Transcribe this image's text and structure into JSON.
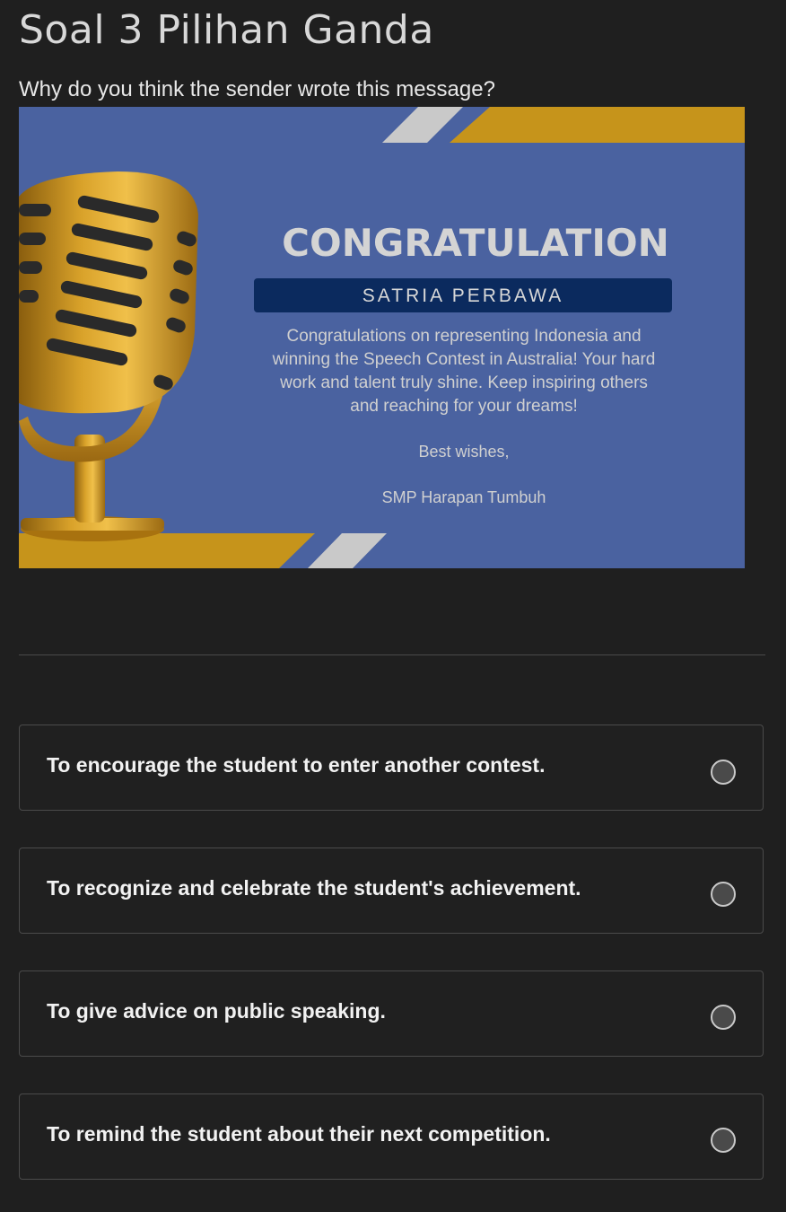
{
  "title": "Soal 3 Pilihan Ganda",
  "question": "Why do you think the sender wrote this message?",
  "card": {
    "heading": "CONGRATULATION",
    "name": "SATRIA PERBAWA",
    "message_lines": [
      "Congratulations on representing Indonesia and",
      "winning the Speech Contest in Australia! Your hard",
      "work and talent truly shine. Keep inspiring others",
      "and reaching for your dreams!"
    ],
    "closing": "Best wishes,",
    "sender": "SMP Harapan Tumbuh",
    "image_icon": "microphone-icon",
    "colors": {
      "background": "#4a62a0",
      "accent": "#c6941b",
      "name_band": "#0b2a5e"
    }
  },
  "options": [
    {
      "label": "To encourage the student to enter another contest.",
      "selected": false
    },
    {
      "label": "To recognize and celebrate the student's achievement.",
      "selected": false
    },
    {
      "label": "To give advice on public speaking.",
      "selected": false
    },
    {
      "label": "To remind the student about their next competition.",
      "selected": false
    }
  ]
}
